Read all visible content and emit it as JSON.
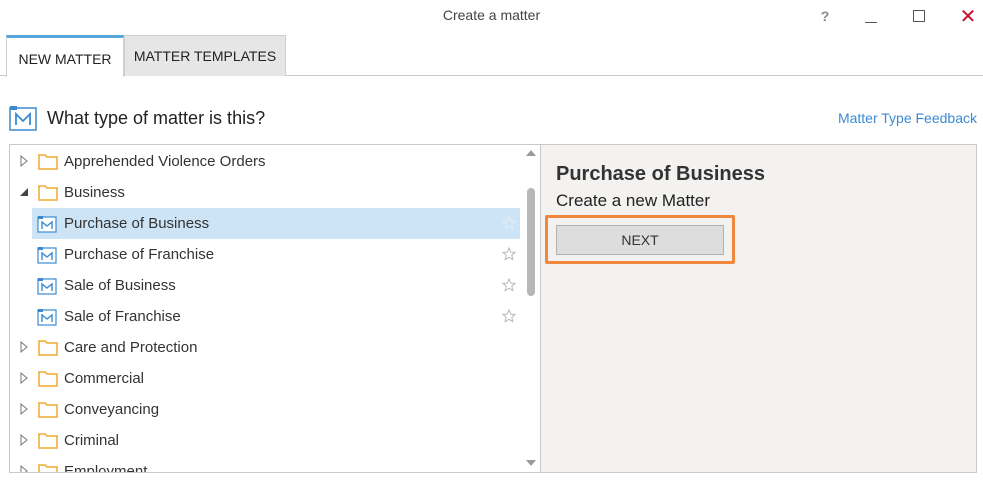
{
  "window": {
    "title": "Create a matter",
    "help_label": "?",
    "close_label": "✕"
  },
  "tabs": [
    {
      "label": "NEW MATTER",
      "active": true
    },
    {
      "label": "MATTER TEMPLATES",
      "active": false
    }
  ],
  "heading": {
    "text": "What type of matter is this?",
    "feedback_link": "Matter Type Feedback"
  },
  "tree": {
    "items": [
      {
        "label": "Apprehended Violence Orders",
        "type": "folder",
        "expanded": false,
        "level": 0
      },
      {
        "label": "Business",
        "type": "folder",
        "expanded": true,
        "level": 0
      },
      {
        "label": "Purchase of Business",
        "type": "matter",
        "level": 1,
        "selected": true
      },
      {
        "label": "Purchase of Franchise",
        "type": "matter",
        "level": 1
      },
      {
        "label": "Sale of Business",
        "type": "matter",
        "level": 1
      },
      {
        "label": "Sale of Franchise",
        "type": "matter",
        "level": 1
      },
      {
        "label": "Care and Protection",
        "type": "folder",
        "expanded": false,
        "level": 0
      },
      {
        "label": "Commercial",
        "type": "folder",
        "expanded": false,
        "level": 0
      },
      {
        "label": "Conveyancing",
        "type": "folder",
        "expanded": false,
        "level": 0
      },
      {
        "label": "Criminal",
        "type": "folder",
        "expanded": false,
        "level": 0
      },
      {
        "label": "Employment",
        "type": "folder",
        "expanded": false,
        "level": 0
      }
    ]
  },
  "detail": {
    "title": "Purchase of Business",
    "subtitle": "Create a new Matter",
    "next_label": "NEXT"
  },
  "colors": {
    "accent": "#56a5db",
    "folder": "#f0a830",
    "selected_row": "#cde4f7",
    "highlight": "#f0883e",
    "close": "#c8102e"
  }
}
